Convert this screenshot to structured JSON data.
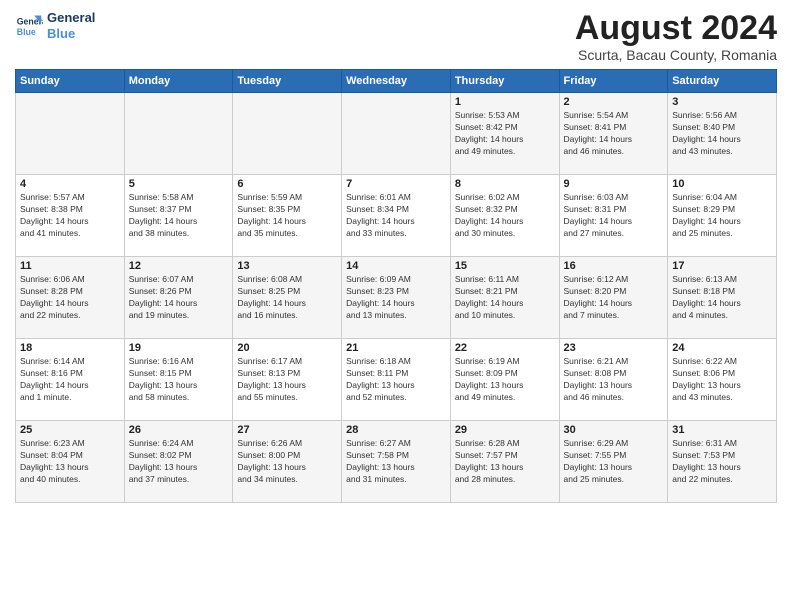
{
  "header": {
    "logo_line1": "General",
    "logo_line2": "Blue",
    "title": "August 2024",
    "subtitle": "Scurta, Bacau County, Romania"
  },
  "days_of_week": [
    "Sunday",
    "Monday",
    "Tuesday",
    "Wednesday",
    "Thursday",
    "Friday",
    "Saturday"
  ],
  "weeks": [
    [
      {
        "day": "",
        "info": ""
      },
      {
        "day": "",
        "info": ""
      },
      {
        "day": "",
        "info": ""
      },
      {
        "day": "",
        "info": ""
      },
      {
        "day": "1",
        "info": "Sunrise: 5:53 AM\nSunset: 8:42 PM\nDaylight: 14 hours\nand 49 minutes."
      },
      {
        "day": "2",
        "info": "Sunrise: 5:54 AM\nSunset: 8:41 PM\nDaylight: 14 hours\nand 46 minutes."
      },
      {
        "day": "3",
        "info": "Sunrise: 5:56 AM\nSunset: 8:40 PM\nDaylight: 14 hours\nand 43 minutes."
      }
    ],
    [
      {
        "day": "4",
        "info": "Sunrise: 5:57 AM\nSunset: 8:38 PM\nDaylight: 14 hours\nand 41 minutes."
      },
      {
        "day": "5",
        "info": "Sunrise: 5:58 AM\nSunset: 8:37 PM\nDaylight: 14 hours\nand 38 minutes."
      },
      {
        "day": "6",
        "info": "Sunrise: 5:59 AM\nSunset: 8:35 PM\nDaylight: 14 hours\nand 35 minutes."
      },
      {
        "day": "7",
        "info": "Sunrise: 6:01 AM\nSunset: 8:34 PM\nDaylight: 14 hours\nand 33 minutes."
      },
      {
        "day": "8",
        "info": "Sunrise: 6:02 AM\nSunset: 8:32 PM\nDaylight: 14 hours\nand 30 minutes."
      },
      {
        "day": "9",
        "info": "Sunrise: 6:03 AM\nSunset: 8:31 PM\nDaylight: 14 hours\nand 27 minutes."
      },
      {
        "day": "10",
        "info": "Sunrise: 6:04 AM\nSunset: 8:29 PM\nDaylight: 14 hours\nand 25 minutes."
      }
    ],
    [
      {
        "day": "11",
        "info": "Sunrise: 6:06 AM\nSunset: 8:28 PM\nDaylight: 14 hours\nand 22 minutes."
      },
      {
        "day": "12",
        "info": "Sunrise: 6:07 AM\nSunset: 8:26 PM\nDaylight: 14 hours\nand 19 minutes."
      },
      {
        "day": "13",
        "info": "Sunrise: 6:08 AM\nSunset: 8:25 PM\nDaylight: 14 hours\nand 16 minutes."
      },
      {
        "day": "14",
        "info": "Sunrise: 6:09 AM\nSunset: 8:23 PM\nDaylight: 14 hours\nand 13 minutes."
      },
      {
        "day": "15",
        "info": "Sunrise: 6:11 AM\nSunset: 8:21 PM\nDaylight: 14 hours\nand 10 minutes."
      },
      {
        "day": "16",
        "info": "Sunrise: 6:12 AM\nSunset: 8:20 PM\nDaylight: 14 hours\nand 7 minutes."
      },
      {
        "day": "17",
        "info": "Sunrise: 6:13 AM\nSunset: 8:18 PM\nDaylight: 14 hours\nand 4 minutes."
      }
    ],
    [
      {
        "day": "18",
        "info": "Sunrise: 6:14 AM\nSunset: 8:16 PM\nDaylight: 14 hours\nand 1 minute."
      },
      {
        "day": "19",
        "info": "Sunrise: 6:16 AM\nSunset: 8:15 PM\nDaylight: 13 hours\nand 58 minutes."
      },
      {
        "day": "20",
        "info": "Sunrise: 6:17 AM\nSunset: 8:13 PM\nDaylight: 13 hours\nand 55 minutes."
      },
      {
        "day": "21",
        "info": "Sunrise: 6:18 AM\nSunset: 8:11 PM\nDaylight: 13 hours\nand 52 minutes."
      },
      {
        "day": "22",
        "info": "Sunrise: 6:19 AM\nSunset: 8:09 PM\nDaylight: 13 hours\nand 49 minutes."
      },
      {
        "day": "23",
        "info": "Sunrise: 6:21 AM\nSunset: 8:08 PM\nDaylight: 13 hours\nand 46 minutes."
      },
      {
        "day": "24",
        "info": "Sunrise: 6:22 AM\nSunset: 8:06 PM\nDaylight: 13 hours\nand 43 minutes."
      }
    ],
    [
      {
        "day": "25",
        "info": "Sunrise: 6:23 AM\nSunset: 8:04 PM\nDaylight: 13 hours\nand 40 minutes."
      },
      {
        "day": "26",
        "info": "Sunrise: 6:24 AM\nSunset: 8:02 PM\nDaylight: 13 hours\nand 37 minutes."
      },
      {
        "day": "27",
        "info": "Sunrise: 6:26 AM\nSunset: 8:00 PM\nDaylight: 13 hours\nand 34 minutes."
      },
      {
        "day": "28",
        "info": "Sunrise: 6:27 AM\nSunset: 7:58 PM\nDaylight: 13 hours\nand 31 minutes."
      },
      {
        "day": "29",
        "info": "Sunrise: 6:28 AM\nSunset: 7:57 PM\nDaylight: 13 hours\nand 28 minutes."
      },
      {
        "day": "30",
        "info": "Sunrise: 6:29 AM\nSunset: 7:55 PM\nDaylight: 13 hours\nand 25 minutes."
      },
      {
        "day": "31",
        "info": "Sunrise: 6:31 AM\nSunset: 7:53 PM\nDaylight: 13 hours\nand 22 minutes."
      }
    ]
  ]
}
